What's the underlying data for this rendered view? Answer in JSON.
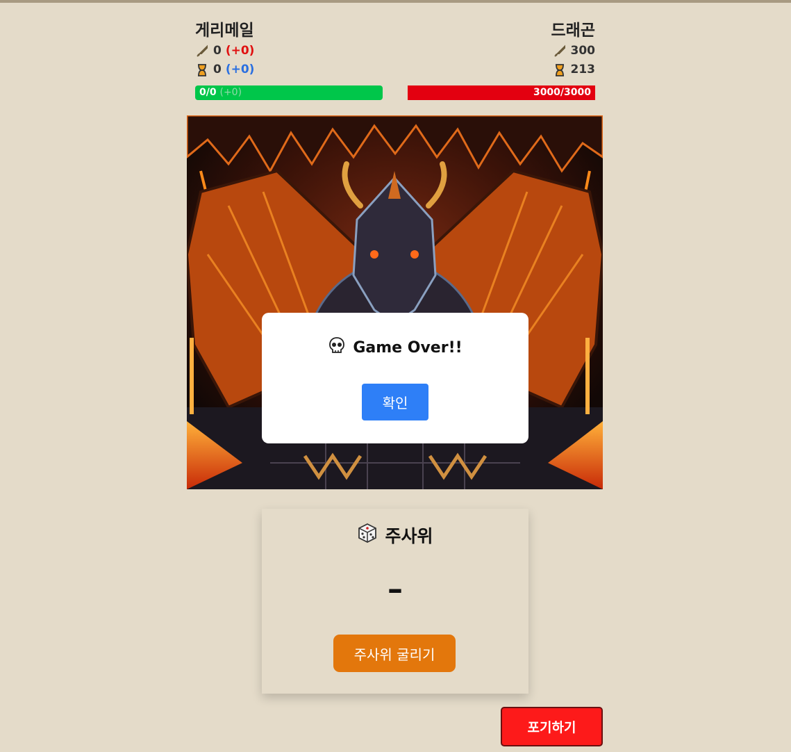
{
  "player": {
    "name": "게리메일",
    "attack": "0",
    "attack_bonus": "(+0)",
    "time": "0",
    "time_bonus": "(+0)",
    "hp_text": "0/0",
    "hp_bonus": "(+0)",
    "hp_fraction": 1.0
  },
  "enemy": {
    "name": "드래곤",
    "attack": "300",
    "time": "213",
    "hp_text": "3000/3000",
    "hp_fraction": 1.0
  },
  "icons": {
    "attack": "sword-icon",
    "time": "hourglass-icon",
    "skull": "skull-icon",
    "dice": "dice-icon"
  },
  "modal": {
    "title": "Game Over!!",
    "confirm_label": "확인"
  },
  "dice": {
    "title": "주사위",
    "value": "–",
    "roll_label": "주사위 굴리기"
  },
  "giveup_label": "포기하기",
  "colors": {
    "player_hp": "#00c64a",
    "enemy_hp": "#e30010",
    "confirm": "#2e7ff7",
    "roll": "#e3770c",
    "giveup": "#fd1a1a"
  }
}
